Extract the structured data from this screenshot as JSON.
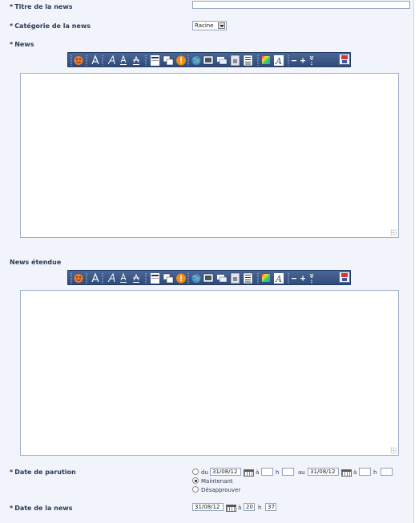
{
  "form": {
    "title_label": "Titre de la news",
    "title_value": "",
    "category_label": "Catégorie de la news",
    "category_value": "Racine",
    "news_label": "News",
    "extended_label": "News étendue",
    "pub_date_label": "Date de parution",
    "news_date_label": "Date de la news",
    "required_mark": "*"
  },
  "publication": {
    "option_range": {
      "du": "du",
      "date_from": "31/08/12",
      "a": "à",
      "h": "h",
      "au": "au",
      "date_to": "31/08/12"
    },
    "option_now": "Maintenant",
    "option_disapprove": "Désapprouver",
    "selected": "Maintenant"
  },
  "news_date": {
    "date": "31/08/12",
    "a": "à",
    "hour": "20",
    "h": "h",
    "minute": "37"
  },
  "toolbar_icons": [
    "smiley-icon",
    "bold-icon",
    "italic-icon",
    "underline-icon",
    "strike-icon",
    "align-icon",
    "copy-icon",
    "alert-icon",
    "globe-icon",
    "image-icon",
    "quote-icon",
    "lock-icon",
    "list-icon",
    "color-icon",
    "font-icon",
    "minus-icon",
    "plus-icon",
    "more-icon",
    "save-icon"
  ],
  "colors": {
    "panel_bg": "#f1f4fa",
    "toolbar_top": "#4a6797",
    "toolbar_bottom": "#2f4b7a",
    "label": "#2a3a55"
  }
}
